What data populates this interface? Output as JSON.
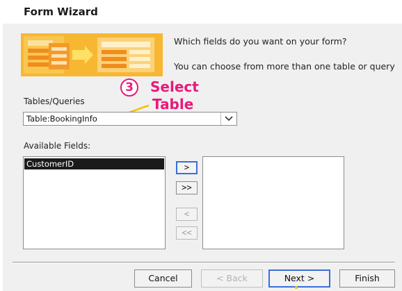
{
  "window": {
    "title": "Form Wizard"
  },
  "prompt": {
    "question": "Which fields do you want on your form?",
    "hint": "You can choose from more than one table or query"
  },
  "tables_queries": {
    "label": "Tables/Queries",
    "selected": "Table:BookingInfo"
  },
  "annotation": {
    "number": "3",
    "line1": "Select",
    "line2": "Table",
    "color": "#e8197a"
  },
  "available_fields": {
    "label": "Available Fields:",
    "items": [
      "CustomerID"
    ]
  },
  "selected_fields": {
    "items": []
  },
  "move_buttons": {
    "add_one": ">",
    "add_all": ">>",
    "remove_one": "<",
    "remove_all": "<<"
  },
  "footer": {
    "cancel": "Cancel",
    "back": "< Back",
    "next": "Next >",
    "finish": "Finish"
  },
  "colors": {
    "accent_border": "#3a6fd8",
    "selection_bg": "#1b1b1b",
    "illustration_orange": "#f5a623"
  }
}
